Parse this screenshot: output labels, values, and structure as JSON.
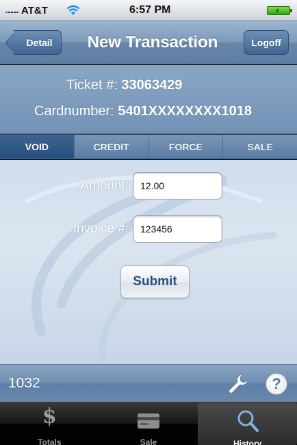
{
  "status_bar": {
    "carrier": "AT&T",
    "time": "6:57 PM"
  },
  "nav": {
    "back_label": "Detail",
    "title": "New Transaction",
    "right_label": "Logoff"
  },
  "info": {
    "ticket_label": "Ticket #:",
    "ticket_value": "33063429",
    "card_label": "Cardnumber:",
    "card_value": "5401XXXXXXXX1018"
  },
  "segments": [
    {
      "label": "VOID",
      "active": true
    },
    {
      "label": "CREDIT",
      "active": false
    },
    {
      "label": "FORCE",
      "active": false
    },
    {
      "label": "SALE",
      "active": false
    }
  ],
  "form": {
    "amount_label": "Amount:",
    "amount_value": "12.00",
    "invoice_label": "Invoice #:",
    "invoice_value": "123456",
    "submit_label": "Submit"
  },
  "toolbar": {
    "batch_number": "1032",
    "settings_icon": "wrench-icon",
    "help_icon": "help-icon",
    "help_glyph": "?"
  },
  "tab_bar": {
    "tabs": [
      {
        "label": "Totals",
        "icon": "dollar-icon",
        "glyph": "$"
      },
      {
        "label": "Sale",
        "icon": "credit-card-icon"
      },
      {
        "label": "History",
        "icon": "magnifier-icon",
        "active": true
      }
    ]
  },
  "colors": {
    "nav_blue": "#7d9abb",
    "segment_active": "#284f7d",
    "form_background": "#d6e2ee",
    "battery_green": "#32a31a"
  }
}
